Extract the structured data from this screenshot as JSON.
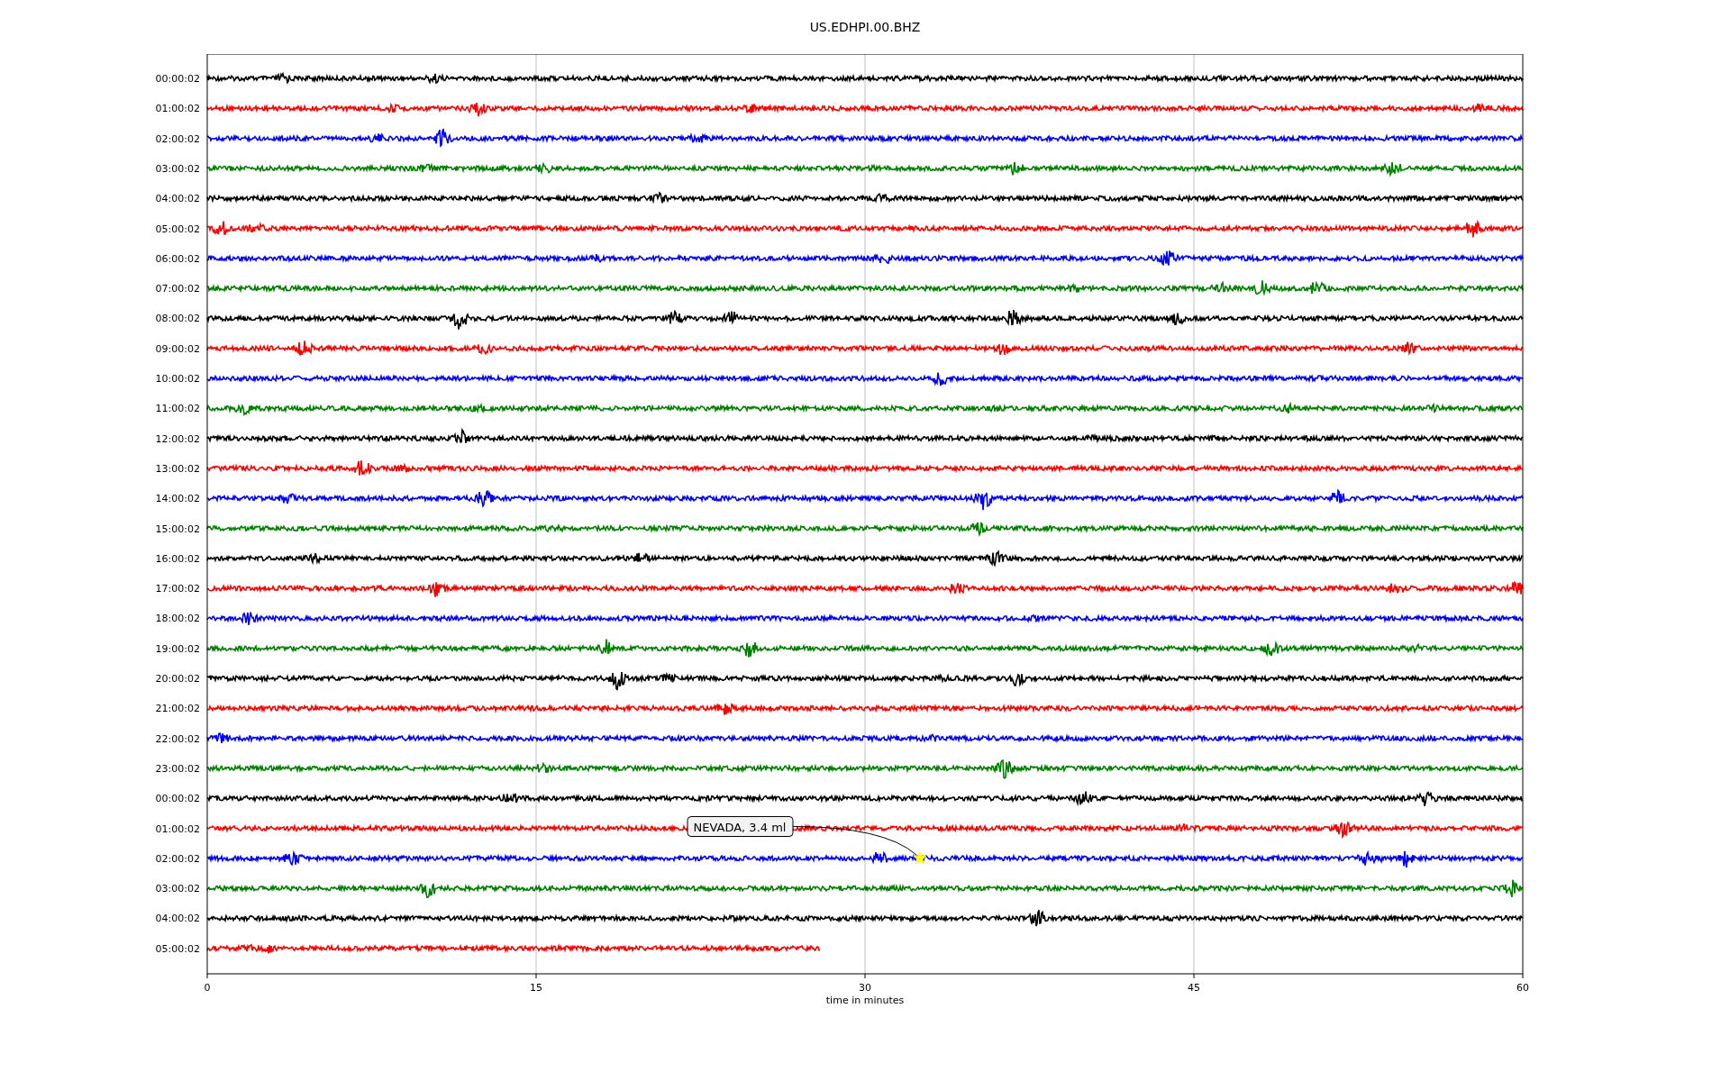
{
  "title": "US.EDHPI.00.BHZ",
  "rows": [
    {
      "label": "00:00:02",
      "color": "#000000",
      "level": 1
    },
    {
      "label": "01:00:02",
      "color": "#ff0000",
      "level": 1
    },
    {
      "label": "02:00:02",
      "color": "#0000ff",
      "level": 1
    },
    {
      "label": "03:00:02",
      "color": "#008000",
      "level": 1
    },
    {
      "label": "04:00:02",
      "color": "#000000",
      "level": 1
    },
    {
      "label": "05:00:02",
      "color": "#ff0000",
      "level": 1
    },
    {
      "label": "06:00:02",
      "color": "#0000ff",
      "level": 1
    },
    {
      "label": "07:00:02",
      "color": "#008000",
      "level": 1
    },
    {
      "label": "08:00:02",
      "color": "#000000",
      "level": 1
    },
    {
      "label": "09:00:02",
      "color": "#ff0000",
      "level": 1
    },
    {
      "label": "10:00:02",
      "color": "#0000ff",
      "level": 1
    },
    {
      "label": "11:00:02",
      "color": "#008000",
      "level": 1
    },
    {
      "label": "12:00:02",
      "color": "#000000",
      "level": 1
    },
    {
      "label": "13:00:02",
      "color": "#ff0000",
      "level": 1
    },
    {
      "label": "14:00:02",
      "color": "#0000ff",
      "level": 1
    },
    {
      "label": "15:00:02",
      "color": "#008000",
      "level": 1
    },
    {
      "label": "16:00:02",
      "color": "#000000",
      "level": 1
    },
    {
      "label": "17:00:02",
      "color": "#ff0000",
      "level": 1
    },
    {
      "label": "18:00:02",
      "color": "#0000ff",
      "level": 1
    },
    {
      "label": "19:00:02",
      "color": "#008000",
      "level": 1
    },
    {
      "label": "20:00:02",
      "color": "#000000",
      "level": 1
    },
    {
      "label": "21:00:02",
      "color": "#ff0000",
      "level": 1
    },
    {
      "label": "22:00:02",
      "color": "#0000ff",
      "level": 1
    },
    {
      "label": "23:00:02",
      "color": "#008000",
      "level": 1
    },
    {
      "label": "00:00:02",
      "color": "#000000",
      "level": 1
    },
    {
      "label": "01:00:02",
      "color": "#ff0000",
      "level": 1
    },
    {
      "label": "02:00:02",
      "color": "#0000ff",
      "level": 1
    },
    {
      "label": "03:00:02",
      "color": "#008000",
      "level": 1
    },
    {
      "label": "04:00:02",
      "color": "#000000",
      "level": 1
    },
    {
      "label": "05:00:02",
      "color": "#ff0000",
      "level": 0.466
    }
  ],
  "xticks": [
    "0",
    "15",
    "30",
    "45",
    "60"
  ],
  "xlabel": "time in minutes",
  "annotation": {
    "text": "NEVADA, 3.4 ml"
  }
}
